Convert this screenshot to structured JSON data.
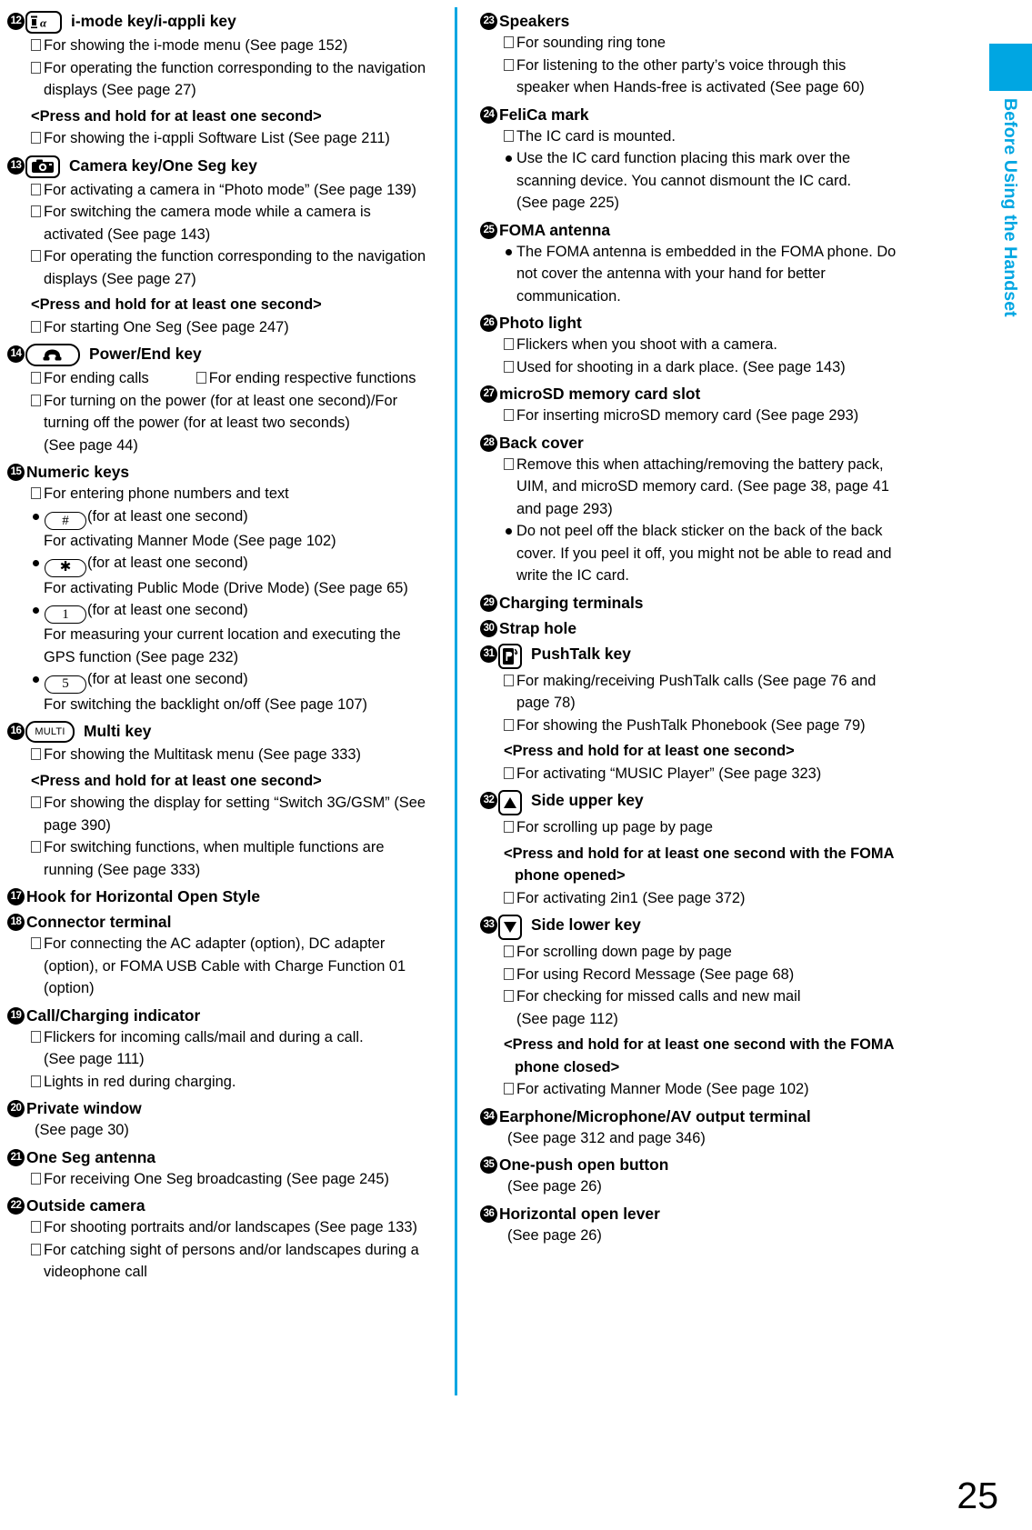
{
  "sidebar": {
    "label": "Before Using the Handset",
    "accent_color": "#00a6e2"
  },
  "page_number": "25",
  "press_hold_note": "<Press and hold for at least one second>",
  "left_column": [
    {
      "number": "12",
      "icon": "imode-key-icon",
      "title": "i-mode key/i-αppli key",
      "lines": [
        {
          "marker": "box",
          "text": "For showing the i-mode menu (See page 152)"
        },
        {
          "marker": "box",
          "text": "For operating the function corresponding to the navigation"
        },
        {
          "marker": "cont",
          "text": "displays (See page 27)"
        },
        {
          "marker": "boldnote",
          "text": "<Press and hold for at least one second>"
        },
        {
          "marker": "box",
          "text": "For showing the i-αppli Software List (See page 211)"
        }
      ]
    },
    {
      "number": "13",
      "icon": "camera-key-icon",
      "title": "Camera key/One Seg key",
      "lines": [
        {
          "marker": "box",
          "text": "For activating a camera in “Photo mode” (See page 139)"
        },
        {
          "marker": "box",
          "text": "For switching the camera mode while a camera is"
        },
        {
          "marker": "cont",
          "text": "activated (See page 143)"
        },
        {
          "marker": "box",
          "text": "For operating the function corresponding to the navigation"
        },
        {
          "marker": "cont",
          "text": "displays (See page 27)"
        },
        {
          "marker": "boldnote",
          "text": "<Press and hold for at least one second>"
        },
        {
          "marker": "box",
          "text": "For starting One Seg (See page 247)"
        }
      ]
    },
    {
      "number": "14",
      "icon": "power-end-key-icon",
      "title": "Power/End key",
      "lines": [
        {
          "marker": "twocol",
          "text": "For ending calls",
          "text2": "For ending respective functions"
        },
        {
          "marker": "box",
          "text": "For turning on the power (for at least one second)/For"
        },
        {
          "marker": "cont",
          "text": "turning off the power (for at least two seconds)"
        },
        {
          "marker": "cont",
          "text": "(See page 44)"
        }
      ]
    },
    {
      "number": "15",
      "icon": null,
      "title": "Numeric keys",
      "lines": [
        {
          "marker": "box",
          "text": "For entering phone numbers and text"
        },
        {
          "marker": "dot-key",
          "key": "#",
          "text": "(for at least one second)"
        },
        {
          "marker": "cont",
          "text": "For activating Manner Mode (See page 102)"
        },
        {
          "marker": "dot-key",
          "key": "✱",
          "text": "(for at least one second)"
        },
        {
          "marker": "cont",
          "text": "For activating Public Mode (Drive Mode) (See page 65)"
        },
        {
          "marker": "dot-key",
          "key": "1",
          "text": "(for at least one second)"
        },
        {
          "marker": "cont",
          "text": "For measuring your current location and executing the"
        },
        {
          "marker": "cont",
          "text": "GPS function (See page 232)"
        },
        {
          "marker": "dot-key",
          "key": "5",
          "text": "(for at least one second)"
        },
        {
          "marker": "cont",
          "text": "For switching the backlight on/off (See page 107)"
        }
      ]
    },
    {
      "number": "16",
      "icon": "multi-key-icon",
      "icon_text": "MULTI",
      "title": "Multi key",
      "lines": [
        {
          "marker": "box",
          "text": "For showing the Multitask menu (See page 333)"
        },
        {
          "marker": "boldnote",
          "text": "<Press and hold for at least one second>"
        },
        {
          "marker": "box",
          "text": "For showing the display for setting “Switch 3G/GSM” (See"
        },
        {
          "marker": "cont",
          "text": "page 390)"
        },
        {
          "marker": "box",
          "text": "For switching functions, when multiple functions are"
        },
        {
          "marker": "cont",
          "text": "running (See page 333)"
        }
      ]
    },
    {
      "number": "17",
      "icon": null,
      "title": "Hook for Horizontal Open Style",
      "lines": []
    },
    {
      "number": "18",
      "icon": null,
      "title": "Connector terminal",
      "lines": [
        {
          "marker": "box",
          "text": "For connecting the AC adapter (option), DC adapter"
        },
        {
          "marker": "cont",
          "text": "(option), or FOMA USB Cable with Charge Function 01"
        },
        {
          "marker": "cont",
          "text": "(option)"
        }
      ]
    },
    {
      "number": "19",
      "icon": null,
      "title": "Call/Charging indicator",
      "lines": [
        {
          "marker": "box",
          "text": "Flickers for incoming calls/mail and during a call."
        },
        {
          "marker": "cont",
          "text": "(See page 111)"
        },
        {
          "marker": "box",
          "text": "Lights in red during charging."
        }
      ]
    },
    {
      "number": "20",
      "icon": null,
      "title": "Private window",
      "lines": [
        {
          "marker": "plain",
          "text": "(See page 30)"
        }
      ]
    },
    {
      "number": "21",
      "icon": null,
      "title": "One Seg antenna",
      "lines": [
        {
          "marker": "box",
          "text": "For receiving One Seg broadcasting (See page 245)"
        }
      ]
    },
    {
      "number": "22",
      "icon": null,
      "title": "Outside camera",
      "lines": [
        {
          "marker": "box",
          "text": "For shooting portraits and/or landscapes (See page 133)"
        },
        {
          "marker": "box",
          "text": "For catching sight of persons and/or landscapes during a"
        },
        {
          "marker": "cont",
          "text": "videophone call"
        }
      ]
    }
  ],
  "right_column": [
    {
      "number": "23",
      "icon": null,
      "title": "Speakers",
      "lines": [
        {
          "marker": "box",
          "text": "For sounding ring tone"
        },
        {
          "marker": "box",
          "text": "For listening to the other party’s voice through this"
        },
        {
          "marker": "cont",
          "text": "speaker when Hands-free is activated (See page 60)"
        }
      ]
    },
    {
      "number": "24",
      "icon": null,
      "title": "FeliCa mark",
      "lines": [
        {
          "marker": "box",
          "text": "The IC card is mounted."
        },
        {
          "marker": "dot",
          "text": "Use the IC card function placing this mark over the"
        },
        {
          "marker": "cont",
          "text": "scanning device. You cannot dismount the IC card."
        },
        {
          "marker": "cont",
          "text": "(See page 225)"
        }
      ]
    },
    {
      "number": "25",
      "icon": null,
      "title": "FOMA antenna",
      "lines": [
        {
          "marker": "dot",
          "text": "The FOMA antenna is embedded in the FOMA phone. Do"
        },
        {
          "marker": "cont",
          "text": "not cover the antenna with your hand for better"
        },
        {
          "marker": "cont",
          "text": "communication."
        }
      ]
    },
    {
      "number": "26",
      "icon": null,
      "title": "Photo light",
      "lines": [
        {
          "marker": "box",
          "text": "Flickers when you shoot with a camera."
        },
        {
          "marker": "box",
          "text": "Used for shooting in a dark place. (See page 143)"
        }
      ]
    },
    {
      "number": "27",
      "icon": null,
      "title": "microSD memory card slot",
      "lines": [
        {
          "marker": "box",
          "text": "For inserting microSD memory card (See page 293)"
        }
      ]
    },
    {
      "number": "28",
      "icon": null,
      "title": "Back cover",
      "lines": [
        {
          "marker": "box",
          "text": "Remove this when attaching/removing the battery pack,"
        },
        {
          "marker": "cont",
          "text": "UIM, and microSD memory card. (See page 38, page 41"
        },
        {
          "marker": "cont",
          "text": "and page 293)"
        },
        {
          "marker": "dot",
          "text": "Do not peel off the black sticker on the back of the back"
        },
        {
          "marker": "cont",
          "text": "cover. If you peel it off, you might not be able to read and"
        },
        {
          "marker": "cont",
          "text": "write the IC card."
        }
      ]
    },
    {
      "number": "29",
      "icon": null,
      "title": "Charging terminals",
      "lines": []
    },
    {
      "number": "30",
      "icon": null,
      "title": "Strap hole",
      "lines": []
    },
    {
      "number": "31",
      "icon": "pushtalk-key-icon",
      "title": "PushTalk key",
      "lines": [
        {
          "marker": "box",
          "text": "For making/receiving PushTalk calls (See page 76 and"
        },
        {
          "marker": "cont",
          "text": "page 78)"
        },
        {
          "marker": "box",
          "text": "For showing the PushTalk Phonebook (See page 79)"
        },
        {
          "marker": "boldnote",
          "text": "<Press and hold for at least one second>"
        },
        {
          "marker": "box",
          "text": "For activating “MUSIC Player” (See page 323)"
        }
      ]
    },
    {
      "number": "32",
      "icon": "side-upper-key-icon",
      "title": "Side upper key",
      "lines": [
        {
          "marker": "box",
          "text": "For scrolling up page by page"
        },
        {
          "marker": "boldnote",
          "text": "<Press and hold for at least one second with the FOMA"
        },
        {
          "marker": "boldcont",
          "text": "phone opened>"
        },
        {
          "marker": "box",
          "text": "For activating 2in1 (See page 372)"
        }
      ]
    },
    {
      "number": "33",
      "icon": "side-lower-key-icon",
      "title": "Side lower key",
      "lines": [
        {
          "marker": "box",
          "text": "For scrolling down page by page"
        },
        {
          "marker": "box",
          "text": "For using Record Message (See page 68)"
        },
        {
          "marker": "box",
          "text": "For checking for missed calls and new mail"
        },
        {
          "marker": "cont",
          "text": "(See page 112)"
        },
        {
          "marker": "boldnote",
          "text": "<Press and hold for at least one second with the FOMA"
        },
        {
          "marker": "boldcont",
          "text": "phone closed>"
        },
        {
          "marker": "box",
          "text": "For activating Manner Mode (See page 102)"
        }
      ]
    },
    {
      "number": "34",
      "icon": null,
      "title": "Earphone/Microphone/AV output terminal",
      "lines": [
        {
          "marker": "plain",
          "text": "(See page 312 and page 346)"
        }
      ]
    },
    {
      "number": "35",
      "icon": null,
      "title": "One-push open button",
      "lines": [
        {
          "marker": "plain",
          "text": "(See page 26)"
        }
      ]
    },
    {
      "number": "36",
      "icon": null,
      "title": "Horizontal open lever",
      "lines": [
        {
          "marker": "plain",
          "text": "(See page 26)"
        }
      ]
    }
  ]
}
